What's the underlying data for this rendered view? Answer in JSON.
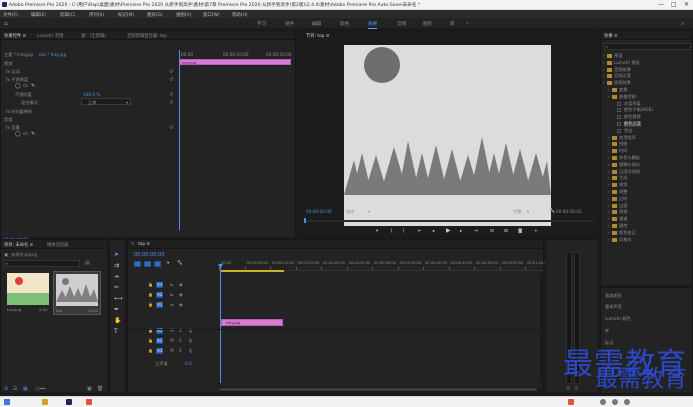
{
  "window": {
    "title": "Adobe Premiere Pro 2020 - C:\\用户\\Rap\\桌面\\素材\\Premiere Pro 2020 从新手到高手\\素材\\第7章 Premiere Pro 2020 从新手到高手(第2版)\\2.4.4\\素材\\Adobe Premiere Pro Auto-Save\\未命名 *",
    "controls": [
      "—",
      "□",
      "✕"
    ]
  },
  "menu": [
    "文件(F)",
    "编辑(E)",
    "剪辑(C)",
    "序列(S)",
    "标记(M)",
    "图形(G)",
    "视图(V)",
    "窗口(W)",
    "帮助(H)"
  ],
  "workspaces": [
    "学习",
    "组件",
    "编辑",
    "颜色",
    "效果",
    "音频",
    "图形",
    "库"
  ],
  "active_workspace": "效果",
  "effect_controls": {
    "tabs": [
      "效果控件 ≡",
      "Lumetri 范围",
      "源：(无剪辑)",
      "音频剪辑混合器: top"
    ],
    "master": "主要 * tray.jpg",
    "clip": "top * tray.jpg",
    "section": "视频",
    "rows": [
      "fx 运动",
      "fx 不透明度",
      "不透明度",
      "混合模式",
      "fx 时间重映射",
      "音频",
      "fx 音量"
    ],
    "opacity_value": "100.0 %",
    "blend_value": "正常",
    "time_start": "00:00",
    "time_mid": "00:00:10:00",
    "time_end": "00:00:20:00",
    "clip_label": "tray.jpg",
    "timecode": "00:00:00:00"
  },
  "program": {
    "tab": "节目: top ≡",
    "timecode": "00:00:00:00",
    "fit": "适合",
    "quality": "完整",
    "duration": "00:00:10:03"
  },
  "project": {
    "tabs": [
      "项目: 未命名 ≡",
      "媒体浏览器"
    ],
    "name": "未命名.prproj",
    "items": [
      {
        "name": "tray.jpg",
        "dur": "5:00"
      },
      {
        "name": "top",
        "dur": "10:03"
      }
    ]
  },
  "timeline": {
    "tab": "top ≡",
    "timecode": "00:00:00:00",
    "ruler": [
      "00:00",
      "00:00:05:00",
      "00:00:10:00",
      "00:00:15:00",
      "00:00:20:00",
      "00:00:25:00",
      "00:00:30:00",
      "00:00:35:00",
      "00:00:40:00",
      "00:00:45:00",
      "00:00:50:00",
      "00:00:55:00",
      "00:01:00:00"
    ],
    "video_tracks": [
      "V3",
      "V2",
      "V1"
    ],
    "audio_tracks": [
      "A1",
      "A2",
      "A3"
    ],
    "master": "主声道",
    "master_value": "0.0",
    "clip_label": "tray.jpg"
  },
  "effects": {
    "tab": "效果 ≡",
    "tree": [
      "预设",
      "Lumetri 预设",
      "音频效果",
      "音频过渡",
      "视频效果",
      "变换",
      "图像控制",
      "灰度亮度",
      "颜色平衡(RGB)",
      "颜色替换",
      "颜色过渡",
      "黑白",
      "实用程序",
      "扭曲",
      "时间",
      "杂色与颗粒",
      "模糊与锐化",
      "沉浸式视频",
      "生成",
      "视频",
      "调整",
      "过时",
      "过渡",
      "透视",
      "通道",
      "键控",
      "颜色校正",
      "风格化"
    ],
    "bottom": [
      "基本图形",
      "基本声音",
      "Lumetri 颜色",
      "库",
      "标记"
    ]
  },
  "watermark": {
    "line1": "最需教育",
    "line2": "最需教育"
  },
  "colors": {
    "accent": "#4b8fe8",
    "clip": "#d47ad1",
    "watermark": "#2b48c9"
  }
}
